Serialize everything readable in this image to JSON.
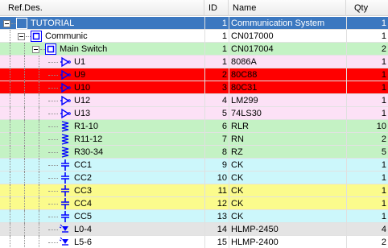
{
  "header": {
    "ref_des": "Ref.Des.",
    "id": "ID",
    "name": "Name",
    "qty": "Qty"
  },
  "colors": {
    "selected": "#3c78c0",
    "pink": "#fce1f6",
    "red": "#ff0000",
    "green": "#c4f2c4",
    "cyan": "#ccf7fb",
    "yellow": "#fbfb8c",
    "gray": "#e4e4e4",
    "white": "#ffffff",
    "icon_blue": "#0000ff"
  },
  "rows": [
    {
      "ref": "TUTORIAL",
      "id": "1",
      "name": "Communication System",
      "qty": "1",
      "level": 0,
      "icon": "module-icon",
      "bg": "selected",
      "expander": true
    },
    {
      "ref": "Communic",
      "id": "1",
      "name": "CN017000",
      "qty": "1",
      "level": 1,
      "icon": "module-icon",
      "bg": "white",
      "expander": true
    },
    {
      "ref": "Main Switch",
      "id": "1",
      "name": "CN017004",
      "qty": "2",
      "level": 2,
      "icon": "module-icon",
      "bg": "green",
      "expander": true
    },
    {
      "ref": "U1",
      "id": "1",
      "name": "8086A",
      "qty": "1",
      "level": 3,
      "icon": "ic-icon",
      "bg": "pink"
    },
    {
      "ref": "U9",
      "id": "2",
      "name": "80C88",
      "qty": "1",
      "level": 3,
      "icon": "ic-icon",
      "bg": "red"
    },
    {
      "ref": "U10",
      "id": "3",
      "name": "80C31",
      "qty": "1",
      "level": 3,
      "icon": "ic-icon",
      "bg": "red"
    },
    {
      "ref": "U12",
      "id": "4",
      "name": "LM299",
      "qty": "1",
      "level": 3,
      "icon": "ic-icon",
      "bg": "pink"
    },
    {
      "ref": "U13",
      "id": "5",
      "name": "74LS30",
      "qty": "1",
      "level": 3,
      "icon": "ic-icon",
      "bg": "pink"
    },
    {
      "ref": "R1-10",
      "id": "6",
      "name": "RLR",
      "qty": "10",
      "level": 3,
      "icon": "resistor-icon",
      "bg": "green"
    },
    {
      "ref": "R11-12",
      "id": "7",
      "name": "RN",
      "qty": "2",
      "level": 3,
      "icon": "resistor-icon",
      "bg": "green"
    },
    {
      "ref": "R30-34",
      "id": "8",
      "name": "RZ",
      "qty": "5",
      "level": 3,
      "icon": "resistor-icon",
      "bg": "green"
    },
    {
      "ref": "CC1",
      "id": "9",
      "name": "CK",
      "qty": "1",
      "level": 3,
      "icon": "capacitor-icon",
      "bg": "cyan"
    },
    {
      "ref": "CC2",
      "id": "10",
      "name": "CK",
      "qty": "1",
      "level": 3,
      "icon": "capacitor-icon",
      "bg": "cyan"
    },
    {
      "ref": "CC3",
      "id": "11",
      "name": "CK",
      "qty": "1",
      "level": 3,
      "icon": "capacitor-icon",
      "bg": "yellow"
    },
    {
      "ref": "CC4",
      "id": "12",
      "name": "CK",
      "qty": "1",
      "level": 3,
      "icon": "capacitor-icon",
      "bg": "yellow"
    },
    {
      "ref": "CC5",
      "id": "13",
      "name": "CK",
      "qty": "1",
      "level": 3,
      "icon": "capacitor-icon",
      "bg": "cyan"
    },
    {
      "ref": "L0-4",
      "id": "14",
      "name": "HLMP-2450",
      "qty": "4",
      "level": 3,
      "icon": "led-icon",
      "bg": "gray"
    },
    {
      "ref": "L5-6",
      "id": "15",
      "name": "HLMP-2400",
      "qty": "2",
      "level": 3,
      "icon": "led-icon",
      "bg": "white"
    }
  ]
}
